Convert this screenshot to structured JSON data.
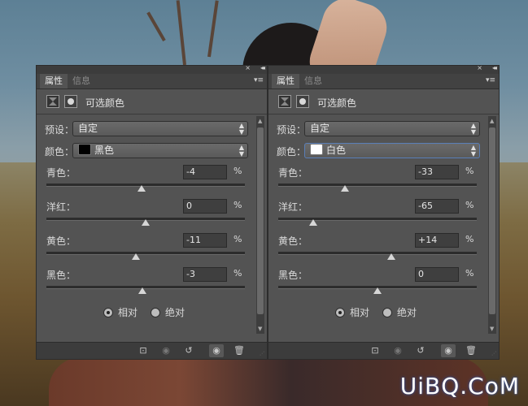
{
  "panels": [
    {
      "tabs": {
        "active": "属性",
        "inactive": "信息"
      },
      "header_title": "可选颜色",
      "preset": {
        "label": "预设：",
        "value": "自定"
      },
      "colors": {
        "label": "颜色：",
        "value": "黑色",
        "swatch": "#000000"
      },
      "sliders": [
        {
          "label": "青色：",
          "value": "-4",
          "unit": "%",
          "level": 0.48
        },
        {
          "label": "洋红：",
          "value": "0",
          "unit": "%",
          "level": 0.5
        },
        {
          "label": "黄色：",
          "value": "-11",
          "unit": "%",
          "level": 0.45
        },
        {
          "label": "黑色：",
          "value": "-3",
          "unit": "%",
          "level": 0.485
        }
      ],
      "method": {
        "relative": "相对",
        "absolute": "绝对",
        "selected": "relative"
      }
    },
    {
      "tabs": {
        "active": "属性",
        "inactive": "信息"
      },
      "header_title": "可选颜色",
      "preset": {
        "label": "预设：",
        "value": "自定"
      },
      "colors": {
        "label": "颜色：",
        "value": "白色",
        "swatch": "#ffffff"
      },
      "sliders": [
        {
          "label": "青色：",
          "value": "-33",
          "unit": "%",
          "level": 0.335
        },
        {
          "label": "洋红：",
          "value": "-65",
          "unit": "%",
          "level": 0.175
        },
        {
          "label": "黄色：",
          "value": "+14",
          "unit": "%",
          "level": 0.57
        },
        {
          "label": "黑色：",
          "value": "0",
          "unit": "%",
          "level": 0.5
        }
      ],
      "method": {
        "relative": "相对",
        "absolute": "绝对",
        "selected": "relative"
      }
    }
  ],
  "footer_icons": [
    "clip-to-layer-icon",
    "view-previous-icon",
    "reset-icon",
    "visibility-eye-icon",
    "trash-icon"
  ],
  "watermark": "UiBQ.CoM"
}
